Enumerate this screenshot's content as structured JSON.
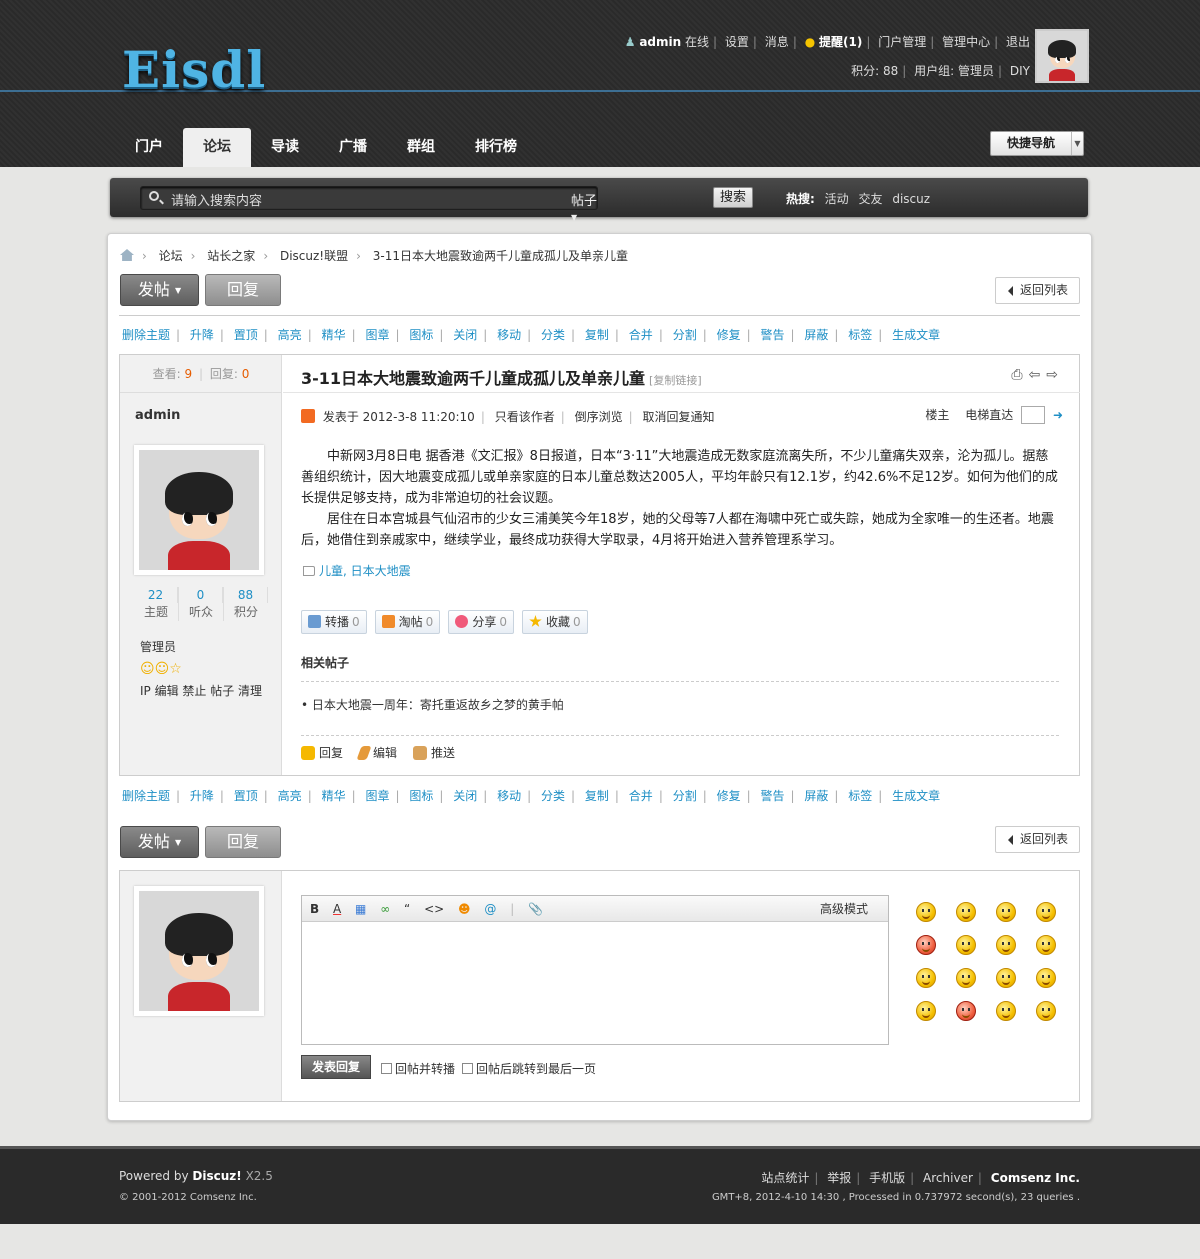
{
  "header": {
    "logo": "Eisdl",
    "user": "admin",
    "online": "在线",
    "links": [
      "设置",
      "消息"
    ],
    "reminder": "提醒(1)",
    "links2": [
      "门户管理",
      "管理中心",
      "退出"
    ],
    "points": "积分: 88",
    "usergroup": "用户组: 管理员",
    "diy": "DIY"
  },
  "nav": {
    "tabs": [
      "门户",
      "论坛",
      "导读",
      "广播",
      "群组",
      "排行榜"
    ],
    "active": "论坛",
    "quick_nav": "快捷导航"
  },
  "search": {
    "placeholder": "请输入搜索内容",
    "type": "帖子",
    "button": "搜索",
    "hot_label": "热搜:",
    "hot_terms": [
      "活动",
      "交友",
      "discuz"
    ]
  },
  "breadcrumb": [
    "论坛",
    "站长之家",
    "Discuz!联盟",
    "3-11日本大地震致逾两千儿童成孤儿及单亲儿童"
  ],
  "buttons": {
    "post": "发帖",
    "reply": "回复",
    "back_list": "返回列表"
  },
  "mod_actions": [
    "删除主题",
    "升降",
    "置顶",
    "高亮",
    "精华",
    "图章",
    "图标",
    "关闭",
    "移动",
    "分类",
    "复制",
    "合并",
    "分割",
    "修复",
    "警告",
    "屏蔽",
    "标签",
    "生成文章"
  ],
  "post": {
    "view_label": "查看:",
    "views": "9",
    "reply_label": "回复:",
    "replies": "0",
    "author": "admin",
    "title": "3-11日本大地震致逾两千儿童成孤儿及单亲儿童",
    "copy_link": "[复制链接]",
    "posted": "发表于 2012-3-8 11:20:10",
    "meta_links": [
      "只看该作者",
      "倒序浏览",
      "取消回复通知"
    ],
    "floor": "楼主",
    "elevator": "电梯直达",
    "paragraphs": [
      "中新网3月8日电 据香港《文汇报》8日报道，日本“3·11”大地震造成无数家庭流离失所，不少儿童痛失双亲，沦为孤儿。据慈善组织统计，因大地震变成孤儿或单亲家庭的日本儿童总数达2005人，平均年龄只有12.1岁，约42.6%不足12岁。如何为他们的成长提供足够支持，成为非常迫切的社会议题。",
      "居住在日本宫城县气仙沼市的少女三浦美笑今年18岁，她的父母等7人都在海啸中死亡或失踪，她成为全家唯一的生还者。地震后，她借住到亲戚家中，继续学业，最终成功获得大学取录，4月将开始进入营养管理系学习。"
    ],
    "tags": "儿童, 日本大地震",
    "share_actions": [
      {
        "label": "转播",
        "count": "0"
      },
      {
        "label": "淘帖",
        "count": "0"
      },
      {
        "label": "分享",
        "count": "0"
      },
      {
        "label": "收藏",
        "count": "0"
      }
    ],
    "related_title": "相关帖子",
    "related_item": "• 日本大地震一周年：寄托重返故乡之梦的黄手帕",
    "bottom_actions": [
      "回复",
      "编辑",
      "推送"
    ]
  },
  "author_stats": [
    {
      "n": "22",
      "l": "主题"
    },
    {
      "n": "0",
      "l": "听众"
    },
    {
      "n": "88",
      "l": "积分"
    }
  ],
  "author_role": "管理员",
  "author_links": "IP 编辑 禁止 帖子 清理",
  "editor": {
    "advanced": "高级模式",
    "submit": "发表回复",
    "check1": "回帖并转播",
    "check2": "回帖后跳转到最后一页"
  },
  "footer": {
    "powered": "Powered by",
    "discuz": "Discuz!",
    "version": "X2.5",
    "copyright": "© 2001-2012 Comsenz Inc.",
    "links": [
      "站点统计",
      "举报",
      "手机版",
      "Archiver"
    ],
    "company": "Comsenz Inc.",
    "stats": "GMT+8, 2012-4-10 14:30 , Processed in 0.737972 second(s), 23 queries ."
  },
  "colors": {
    "accent": "#1f8fc5",
    "header_bg": "#2a2a2a",
    "highlight": "#e65c00"
  }
}
